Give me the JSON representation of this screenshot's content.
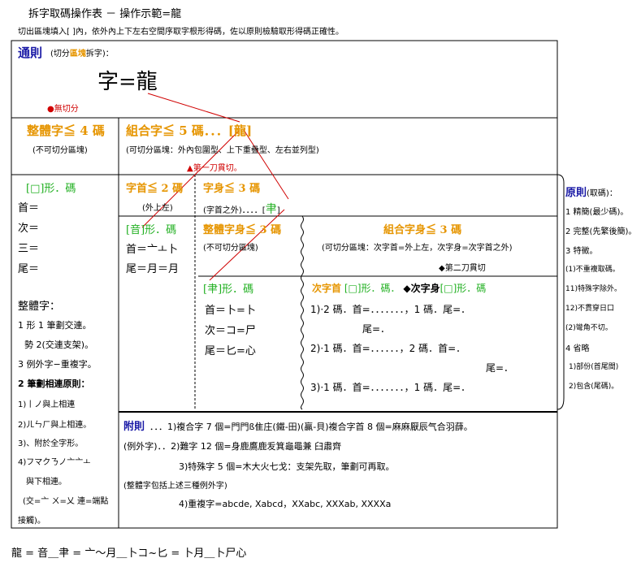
{
  "header": {
    "title": "拆字取碼操作表 － 操作示範=龍",
    "subtitle": "切出區塊填入[ ]內，依外內上下左右空間序取字根形得碼，佐以原則檢驗取形得碼正確性。"
  },
  "rule": {
    "label": "通則",
    "desc_pre": "(切分",
    "desc_hl": "區塊",
    "desc_post": "拆字)：",
    "example": "字=龍",
    "no_cut": "●無切分"
  },
  "whole": {
    "title": "整體字≦ 4 碼",
    "desc": "(不可切分區塊)",
    "shape_title": "[□]形．碼",
    "lines": [
      "首＝",
      "次＝",
      "三＝",
      "尾＝"
    ],
    "zhengti": "整體字：",
    "r1": "1 形 1 筆劃交連。",
    "r1b": "勢 2(交連支架)。",
    "r2": "3 例外字−重複字。",
    "r3": "2 筆劃相連原則：",
    "r4": "1)丨ノ與上相連",
    "r5": "2)ㄦㄣㄏ與上相連。",
    "r6": "3)、附於全字形。",
    "r7": "4)フマクㄋノ亠亠ㅗ",
    "r8": "與下相連。",
    "r9": "(交=亠 ㄨ=乂 連=端點",
    "r10": "接觸)。"
  },
  "combo": {
    "title": "組合字≦ 5 碼．．．[龍]",
    "desc": "(可切分區塊：外內包圍型、上下重疊型、左右並列型)",
    "cut1": "▲第一刀貫切。"
  },
  "head": {
    "title": "字首≦ 2 碼",
    "desc": "(外上左)",
    "shape_title": "[音]形．碼",
    "lines": [
      "首＝亠ㅗ卜",
      "尾＝月＝月"
    ]
  },
  "body": {
    "title": "字身≦ 3 碼",
    "desc": "(字首之外)．．．．[",
    "glyph": "𦘒",
    "desc_end": "]"
  },
  "wholebody": {
    "title": "整體字身≦ 3 碼",
    "desc": "(不可切分區塊)",
    "shape_title": "[𦘒]形．碼",
    "lines": [
      "首＝卜=卜",
      "次＝コ=尸",
      "尾＝匕=心"
    ]
  },
  "combobody": {
    "title": "組合字身≦ 3 碼",
    "desc": "(可切分區塊：次字首=外上左，次字身=次字首之外)",
    "cut2": "◆第二刀貫切",
    "sub_a": "次字首",
    "sub_b": "[□]形．碼．",
    "sub_c": "◆次字身",
    "sub_d": "[□]形．碼",
    "rows": [
      [
        "1)·2 碼．首=．．．．．．．，1 碼．尾=．",
        "尾=．"
      ],
      [
        "2)·1 碼．首=．．．．．．，2 碼．首=．",
        "尾=．"
      ],
      [
        "3)·1 碼．首=．．．．．．．，1 碼．尾=．",
        ""
      ]
    ]
  },
  "principles": {
    "title": "原則",
    "title_post": "(取碼)：",
    "items": [
      "1 精簡(最少碼)。",
      "2 完整(先繁後簡)。",
      "3 特徵。",
      "(1)不重複取碼。",
      "11)特殊字除外。",
      "12)不貫穿日口",
      "(2)彎角不切。",
      "4 省略",
      "1)部份(首尾間)",
      "2)包含(尾碼)。"
    ]
  },
  "appendix": {
    "label": "附則",
    "l1": "．．．1)複合字 7 個=門門ß隹庄(鐵-田)(贏-貝)複合字首 8 個=麻麻厭辰气合羽薛。",
    "l2": "(例外字)．．2)難字 12 個=身鹿鷹鹿叐箕龜黽兼 臼肅齊",
    "l3": "3)特殊字 5 個=木大火七戈：支架先取，筆劃可再取。",
    "l4": "(整體字包括上述三種例外字)",
    "l5": "4)重複字=abcde, Xabcd，XXabc, XXXab, XXXXa"
  },
  "footer": {
    "formula": "龍 = 音＿𦘒 = 亠～月＿卜コ~匕 = 卜月＿卜尸心"
  }
}
